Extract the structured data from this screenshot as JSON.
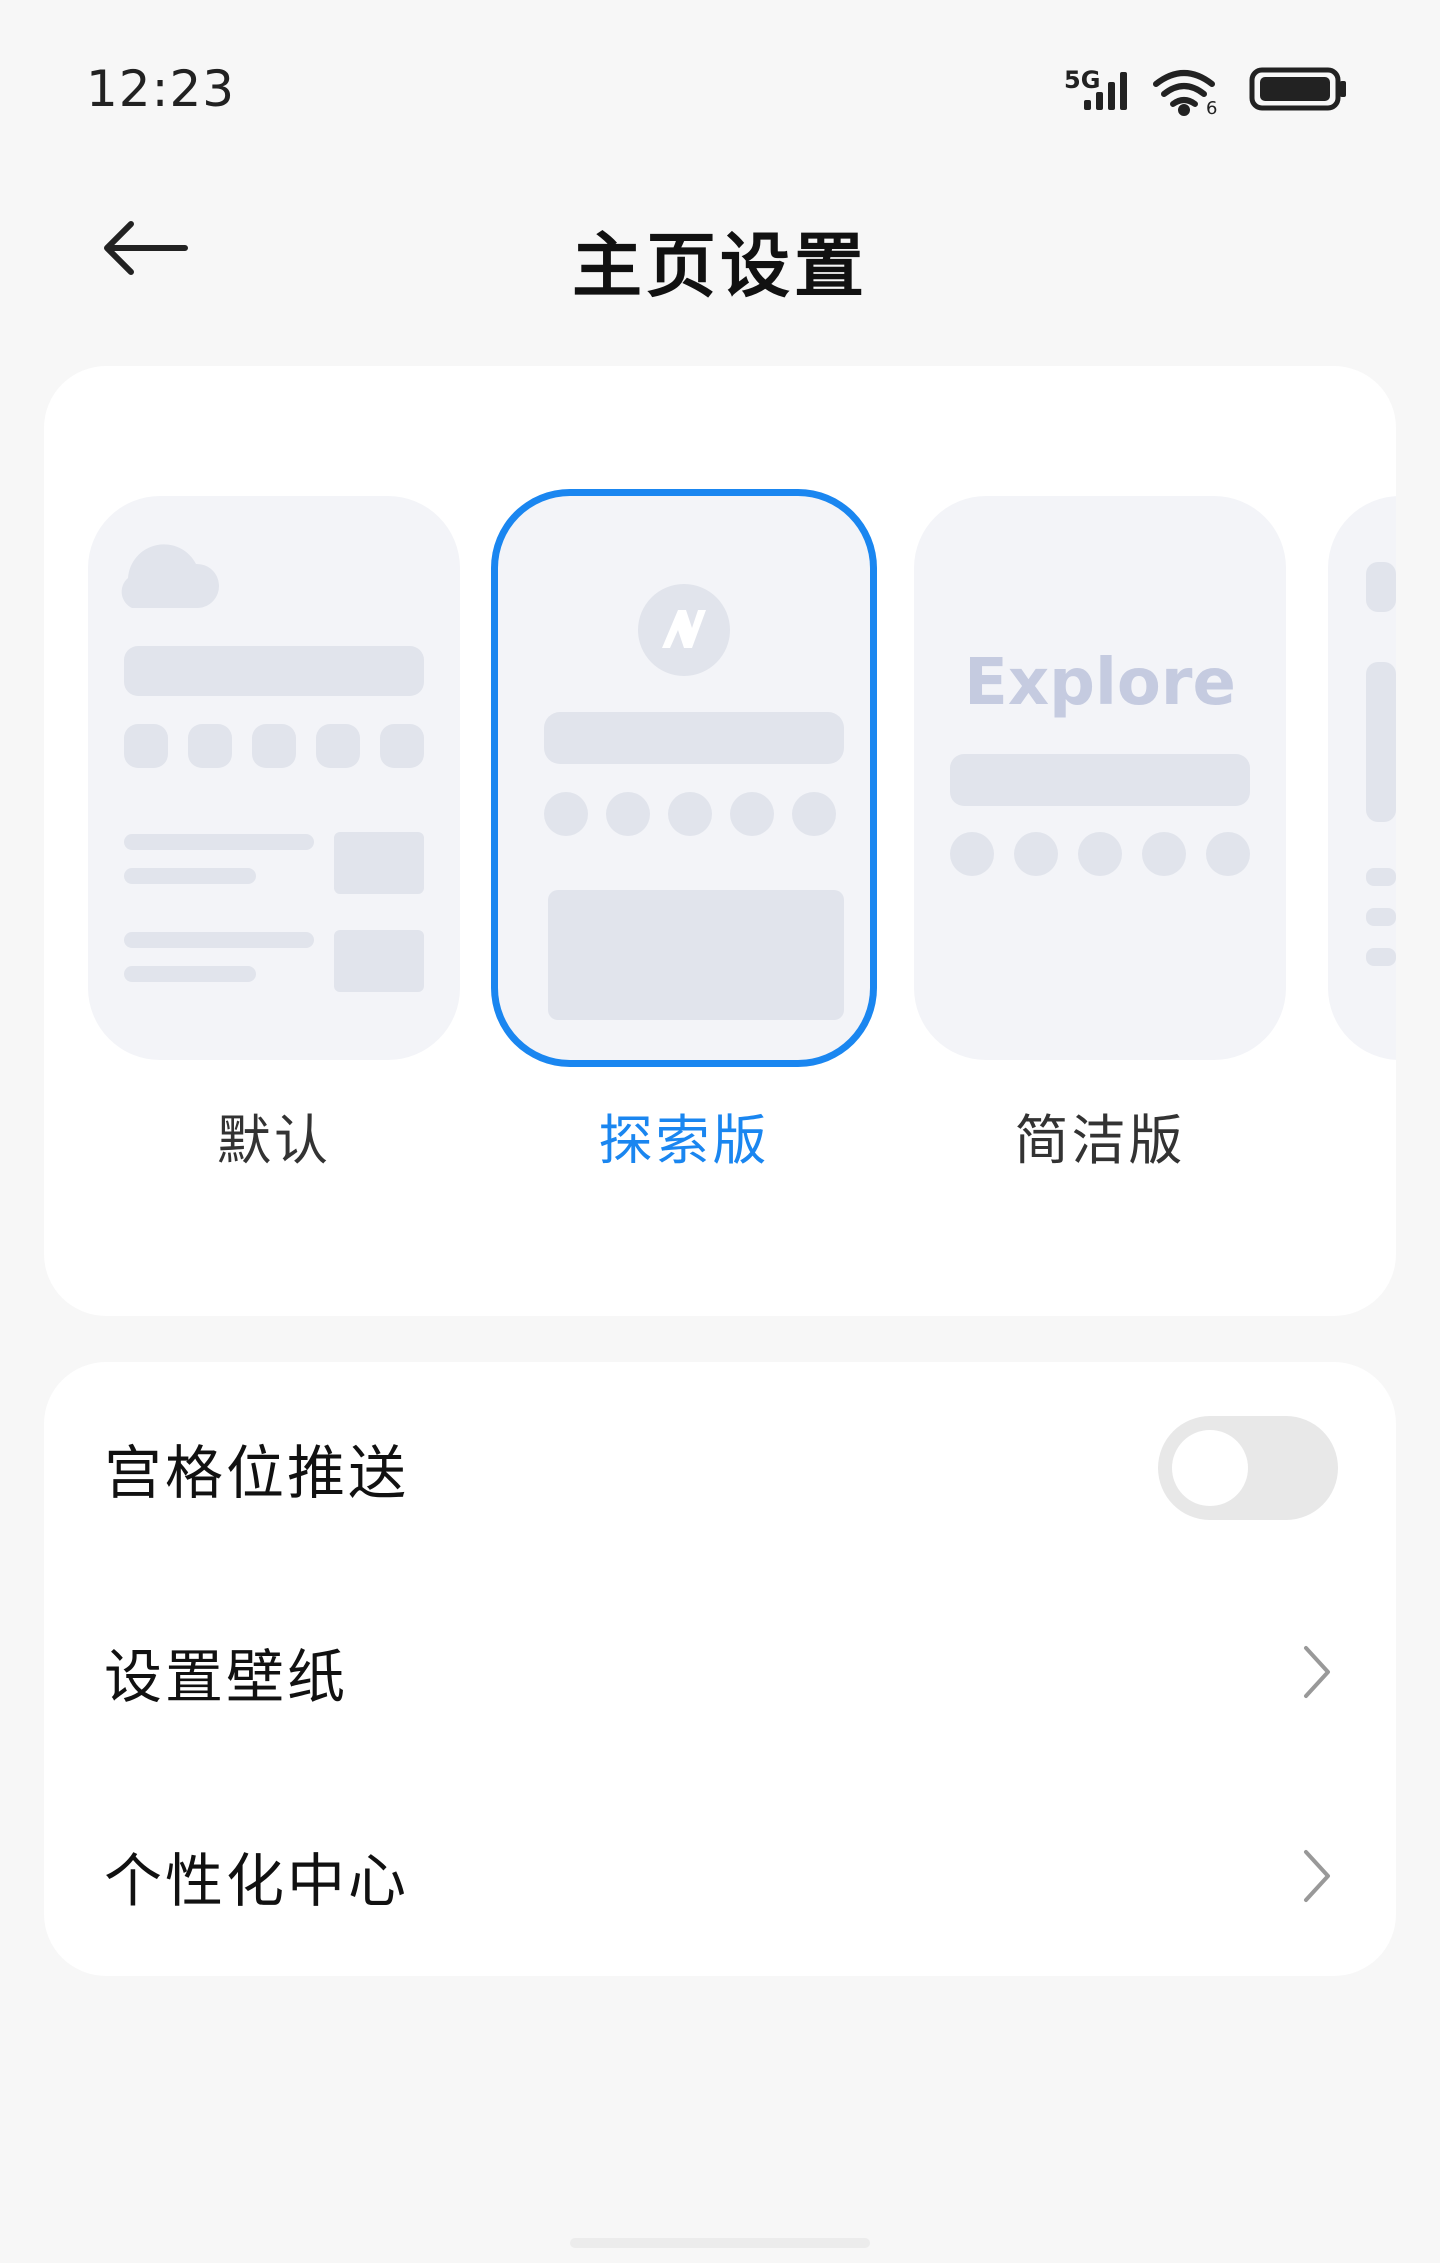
{
  "status_bar": {
    "time": "12:23",
    "network": "5G",
    "wifi_badge": "6"
  },
  "nav": {
    "title": "主页设置"
  },
  "styles": {
    "selected_index": 1,
    "options": [
      {
        "label": "默认"
      },
      {
        "label": "探索版"
      },
      {
        "label": "简洁版"
      }
    ],
    "explore_preview_text": "Explore"
  },
  "settings": {
    "rows": [
      {
        "label": "宫格位推送",
        "control": "toggle",
        "toggle_on": false
      },
      {
        "label": "设置壁纸",
        "control": "chevron"
      },
      {
        "label": "个性化中心",
        "control": "chevron"
      }
    ]
  },
  "colors": {
    "accent": "#1a86f0",
    "preview_bg": "#f3f4f8",
    "preview_block": "#e1e4ec"
  }
}
